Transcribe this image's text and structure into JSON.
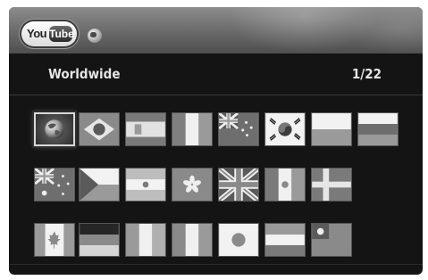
{
  "header": {
    "logo_you": "You",
    "logo_tube": "Tube",
    "globe_icon": "globe-icon"
  },
  "region": {
    "title": "Worldwide",
    "page_indicator": "1/22"
  },
  "grid": {
    "selected_index": 0,
    "tiles": [
      {
        "label": "",
        "icon": "globe-icon"
      },
      {
        "label": "",
        "icon": "brazil-flag"
      },
      {
        "label": "",
        "icon": "spain-flag"
      },
      {
        "label": "",
        "icon": "france-flag"
      },
      {
        "label": "",
        "icon": "new-zealand-flag"
      },
      {
        "label": "",
        "icon": "south-korea-flag"
      },
      {
        "label": "",
        "icon": "poland-flag"
      },
      {
        "label": "",
        "icon": "russia-flag"
      },
      {
        "label": "",
        "icon": "australia-flag"
      },
      {
        "label": "",
        "icon": "czech-flag"
      },
      {
        "label": "",
        "icon": "argentina-flag"
      },
      {
        "label": "",
        "icon": "hong-kong-flag"
      },
      {
        "label": "",
        "icon": "united-kingdom-flag"
      },
      {
        "label": "",
        "icon": "mexico-flag"
      },
      {
        "label": "",
        "icon": "sweden-flag"
      },
      {
        "label": "",
        "icon": "canada-flag"
      },
      {
        "label": "",
        "icon": "germany-flag"
      },
      {
        "label": "",
        "icon": "ireland-flag"
      },
      {
        "label": "",
        "icon": "italy-flag"
      },
      {
        "label": "",
        "icon": "japan-flag"
      },
      {
        "label": "",
        "icon": "netherlands-flag"
      },
      {
        "label": "",
        "icon": "taiwan-flag"
      }
    ]
  }
}
